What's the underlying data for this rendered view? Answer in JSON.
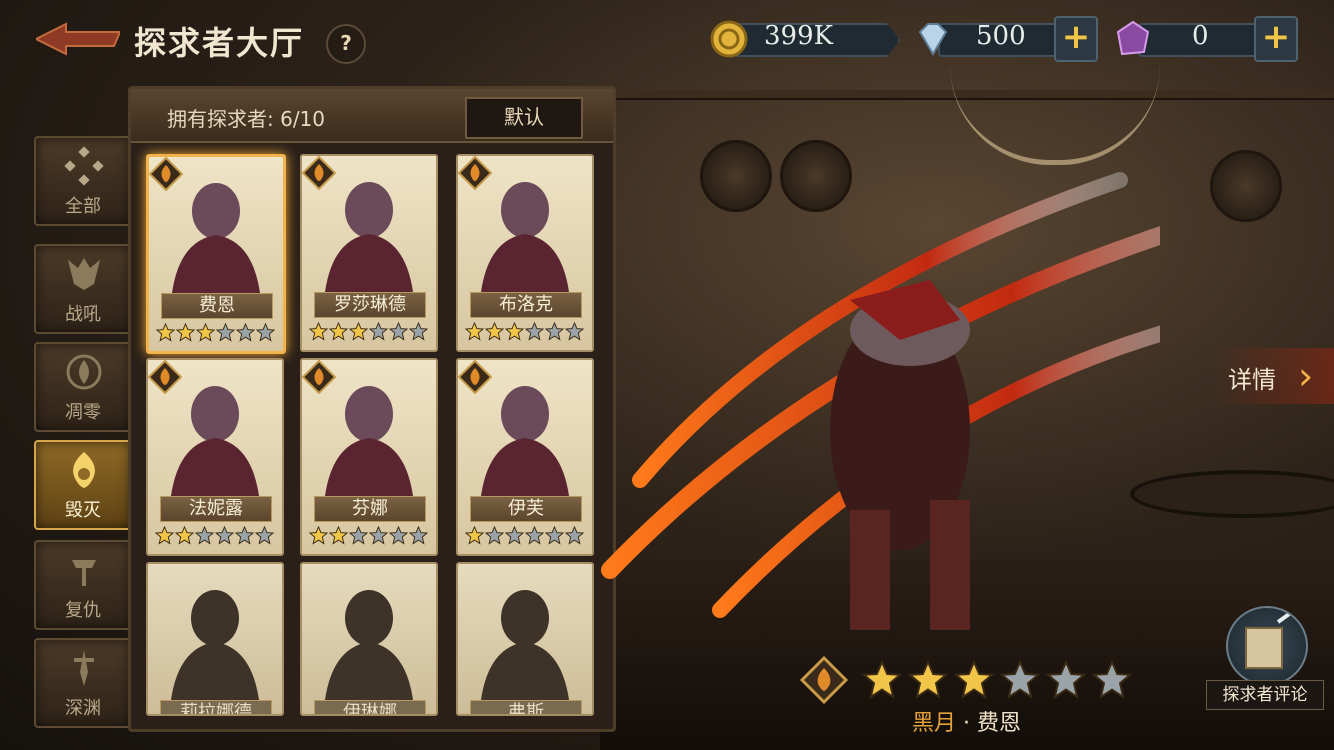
{
  "header": {
    "title": "探求者大厅",
    "help": "?"
  },
  "currencies": {
    "gold": "399K",
    "diamond": "500",
    "crystal": "0",
    "plus": "+"
  },
  "categories": [
    {
      "label": "全部"
    },
    {
      "label": "战吼"
    },
    {
      "label": "凋零"
    },
    {
      "label": "毁灭"
    },
    {
      "label": "复仇"
    },
    {
      "label": "深渊"
    }
  ],
  "panel": {
    "owned": "拥有探求者: 6/10",
    "default_button": "默认"
  },
  "cards": [
    {
      "name": "费恩",
      "stars": 3,
      "selected": true
    },
    {
      "name": "罗莎琳德",
      "stars": 3
    },
    {
      "name": "布洛克",
      "stars": 3
    },
    {
      "name": "法妮露",
      "stars": 2
    },
    {
      "name": "芬娜",
      "stars": 2
    },
    {
      "name": "伊芙",
      "stars": 1
    },
    {
      "name": "莉拉娜德"
    },
    {
      "name": "伊琳娜"
    },
    {
      "name": "弗斯"
    }
  ],
  "detail": {
    "button_label": "详情",
    "arrow": "›",
    "stars": 3,
    "faction": "黑月",
    "separator": "·",
    "name": "费恩"
  },
  "review": {
    "label": "探求者评论"
  },
  "colors": {
    "gold": "#f2b44a",
    "star_on": "#f0c548",
    "star_off": "#9aa4a8"
  }
}
